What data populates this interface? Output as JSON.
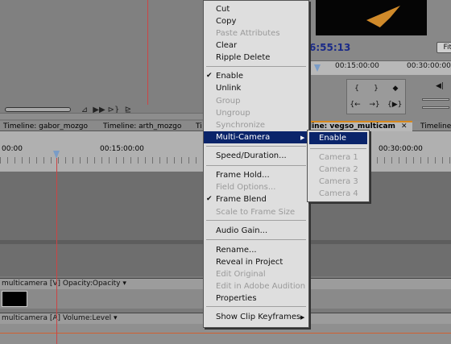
{
  "source": {
    "controls": [
      "⊿",
      "▶▶",
      "⊳}",
      "⊵"
    ]
  },
  "program": {
    "timecode": "6:55:13",
    "fit_label": "Fit",
    "ruler_times": [
      "00:15:00:00",
      "00:30:00:00"
    ],
    "buttons": [
      "{",
      "}",
      "◆",
      "◀|",
      "{←",
      "→}",
      "{▶}",
      ""
    ]
  },
  "tabs": [
    {
      "label": "Timeline: gabor_mozgo"
    },
    {
      "label": "Timeline: arth_mozgo"
    },
    {
      "label": "Ti"
    },
    {
      "label": "line: vegso_multicam"
    },
    {
      "label": "Timeline:"
    }
  ],
  "timeline": {
    "ruler_times": [
      "00:00",
      "00:15:00:00",
      "00:30:00:00"
    ],
    "video_track": "multicamera [V]  Opacity:Opacity ▾",
    "audio_track": "multicamera [A]  Volume:Level ▾"
  },
  "context_menu": {
    "items": [
      {
        "label": "Cut",
        "disabled": false
      },
      {
        "label": "Copy",
        "disabled": false
      },
      {
        "label": "Paste Attributes",
        "disabled": true
      },
      {
        "label": "Clear",
        "disabled": false
      },
      {
        "label": "Ripple Delete",
        "disabled": false
      },
      {
        "label": "Enable",
        "disabled": false,
        "checked": true
      },
      {
        "label": "Unlink",
        "disabled": false
      },
      {
        "label": "Group",
        "disabled": true
      },
      {
        "label": "Ungroup",
        "disabled": true
      },
      {
        "label": "Synchronize",
        "disabled": true
      },
      {
        "label": "Multi-Camera",
        "disabled": false,
        "submenu": true,
        "highlighted": true
      },
      {
        "label": "Speed/Duration...",
        "disabled": false
      },
      {
        "label": "Frame Hold...",
        "disabled": false
      },
      {
        "label": "Field Options...",
        "disabled": true
      },
      {
        "label": "Frame Blend",
        "disabled": false,
        "checked": true
      },
      {
        "label": "Scale to Frame Size",
        "disabled": true
      },
      {
        "label": "Audio Gain...",
        "disabled": false
      },
      {
        "label": "Rename...",
        "disabled": false
      },
      {
        "label": "Reveal in Project",
        "disabled": false
      },
      {
        "label": "Edit Original",
        "disabled": true
      },
      {
        "label": "Edit in Adobe Audition",
        "disabled": true
      },
      {
        "label": "Properties",
        "disabled": false
      },
      {
        "label": "Show Clip Keyframes",
        "disabled": false,
        "submenu": true
      }
    ],
    "check_glyph": "✔",
    "arrow_glyph": "▶"
  },
  "submenu": {
    "items": [
      {
        "label": "Enable",
        "disabled": false,
        "highlighted": true
      },
      {
        "label": "Camera 1",
        "disabled": true
      },
      {
        "label": "Camera 2",
        "disabled": true
      },
      {
        "label": "Camera 3",
        "disabled": true
      },
      {
        "label": "Camera 4",
        "disabled": true
      }
    ]
  },
  "colors": {
    "menu_highlight": "#0a246a",
    "active_tab_accent": "#d7891e",
    "playhead_line": "#cc4444",
    "timecode": "#1a2a88"
  }
}
